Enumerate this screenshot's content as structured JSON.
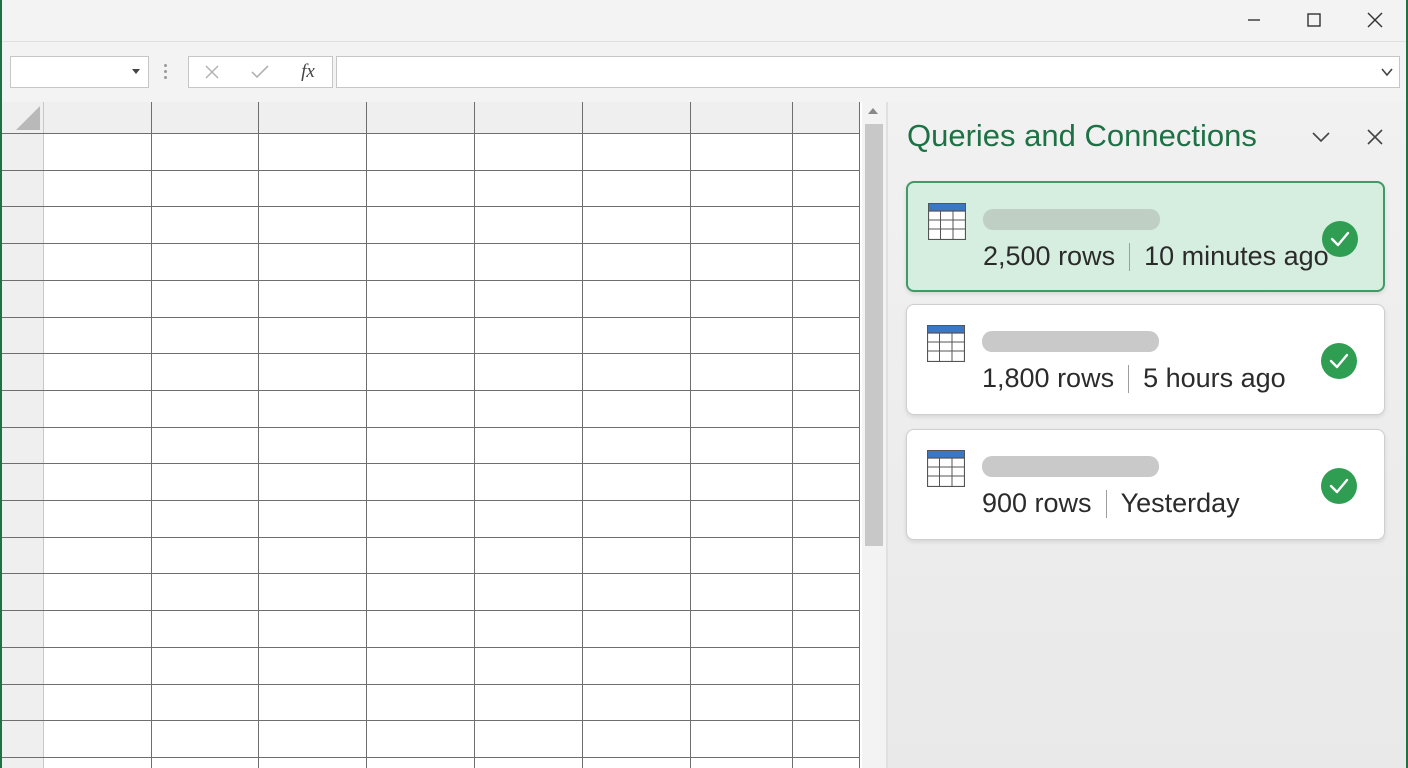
{
  "window": {
    "buttons": [
      {
        "name": "minimize",
        "icon": "minimize-icon"
      },
      {
        "name": "maximize",
        "icon": "maximize-icon"
      },
      {
        "name": "close",
        "icon": "close-icon"
      }
    ]
  },
  "formula_bar": {
    "name_box_value": "",
    "cancel_icon": "x-icon",
    "enter_icon": "checkmark-icon",
    "function_label": "fx",
    "formula_value": ""
  },
  "pane": {
    "title": "Queries and Connections",
    "collapse_icon": "chevron-down-icon",
    "close_icon": "close-icon",
    "queries": [
      {
        "rows": "2,500 rows",
        "refreshed": "10 minutes ago",
        "status": "success",
        "selected": true
      },
      {
        "rows": "1,800 rows",
        "refreshed": "5 hours ago",
        "status": "success",
        "selected": false
      },
      {
        "rows": "900 rows",
        "refreshed": "Yesterday",
        "status": "success",
        "selected": false
      }
    ]
  },
  "colors": {
    "accent": "#1e7145",
    "success": "#2f9e52",
    "selected_card_bg": "#d6eedf",
    "table_icon_header": "#3a78c6"
  }
}
